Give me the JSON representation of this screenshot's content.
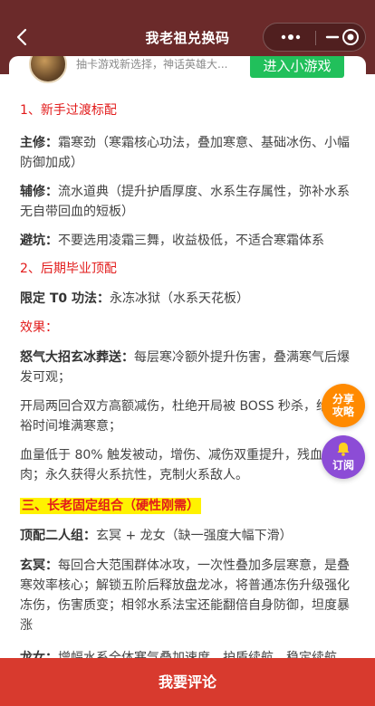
{
  "header": {
    "title": "我老祖兑换码"
  },
  "promo": {
    "desc": "抽卡游戏新选择，神话英雄大...",
    "button": "进入小游戏"
  },
  "content": {
    "s1_title": "1、新手过渡标配",
    "p1_label": "主修：",
    "p1_text": "霜寒劲（寒霜核心功法，叠加寒意、基础冰伤、小幅防御加成）",
    "p2_label": "辅修：",
    "p2_text": "流水道典（提升护盾厚度、水系生存属性，弥补水系无自带回血的短板）",
    "p3_label": "避坑：",
    "p3_text": "不要选用凌霜三舞，收益极低，不适合寒霜体系",
    "s2_title": "2、后期毕业顶配",
    "p4_label": "限定 T0 功法：",
    "p4_text": "永冻冰狱（水系天花板）",
    "effect_label": "效果：",
    "p5_label": "怒气大招玄冰葬送：",
    "p5_text": "每层寒冷额外提升伤害，叠满寒气后爆发可观；",
    "p6_text": "开局两回合双方高额减伤，杜绝开局被 BOSS 秒杀，给你充裕时间堆满寒意；",
    "p7_text": "血量低于 80% 触发被动，增伤、减伤双重提升，残血也能肉；永久获得火系抗性，克制火系敌人。",
    "s3_title": "三、长老固定组合（硬性刚需）",
    "p8_label": "顶配二人组：",
    "p8_text": "玄冥 + 龙女（缺一强度大幅下滑）",
    "p9_label": "玄冥：",
    "p9_text": "每回合大范围群体冰攻，一次性叠加多层寒意，是叠寒效率核心；解锁五阶后释放盘龙冰，将普通冻伤升级强化冻伤，伤害质变；相邻水系法宝还能翻倍自身防御，坦度暴涨",
    "p10_label": "龙女：",
    "p10_text": "增幅水系全体寒气叠加速度，护盾续航，稳定续航"
  },
  "fab": {
    "share": "分享攻略",
    "share_l1": "分享",
    "share_l2": "攻略",
    "subscribe": "订阅"
  },
  "footer": {
    "comment": "我要评论"
  },
  "colors": {
    "header_bg": "#6b2a2a",
    "accent_red": "#e21b1b",
    "cta_green": "#21c05b",
    "footer_bg": "#d83a2e",
    "fab_orange": "#ff8a00",
    "fab_purple": "#8c4cd6",
    "highlight": "#fff200"
  }
}
